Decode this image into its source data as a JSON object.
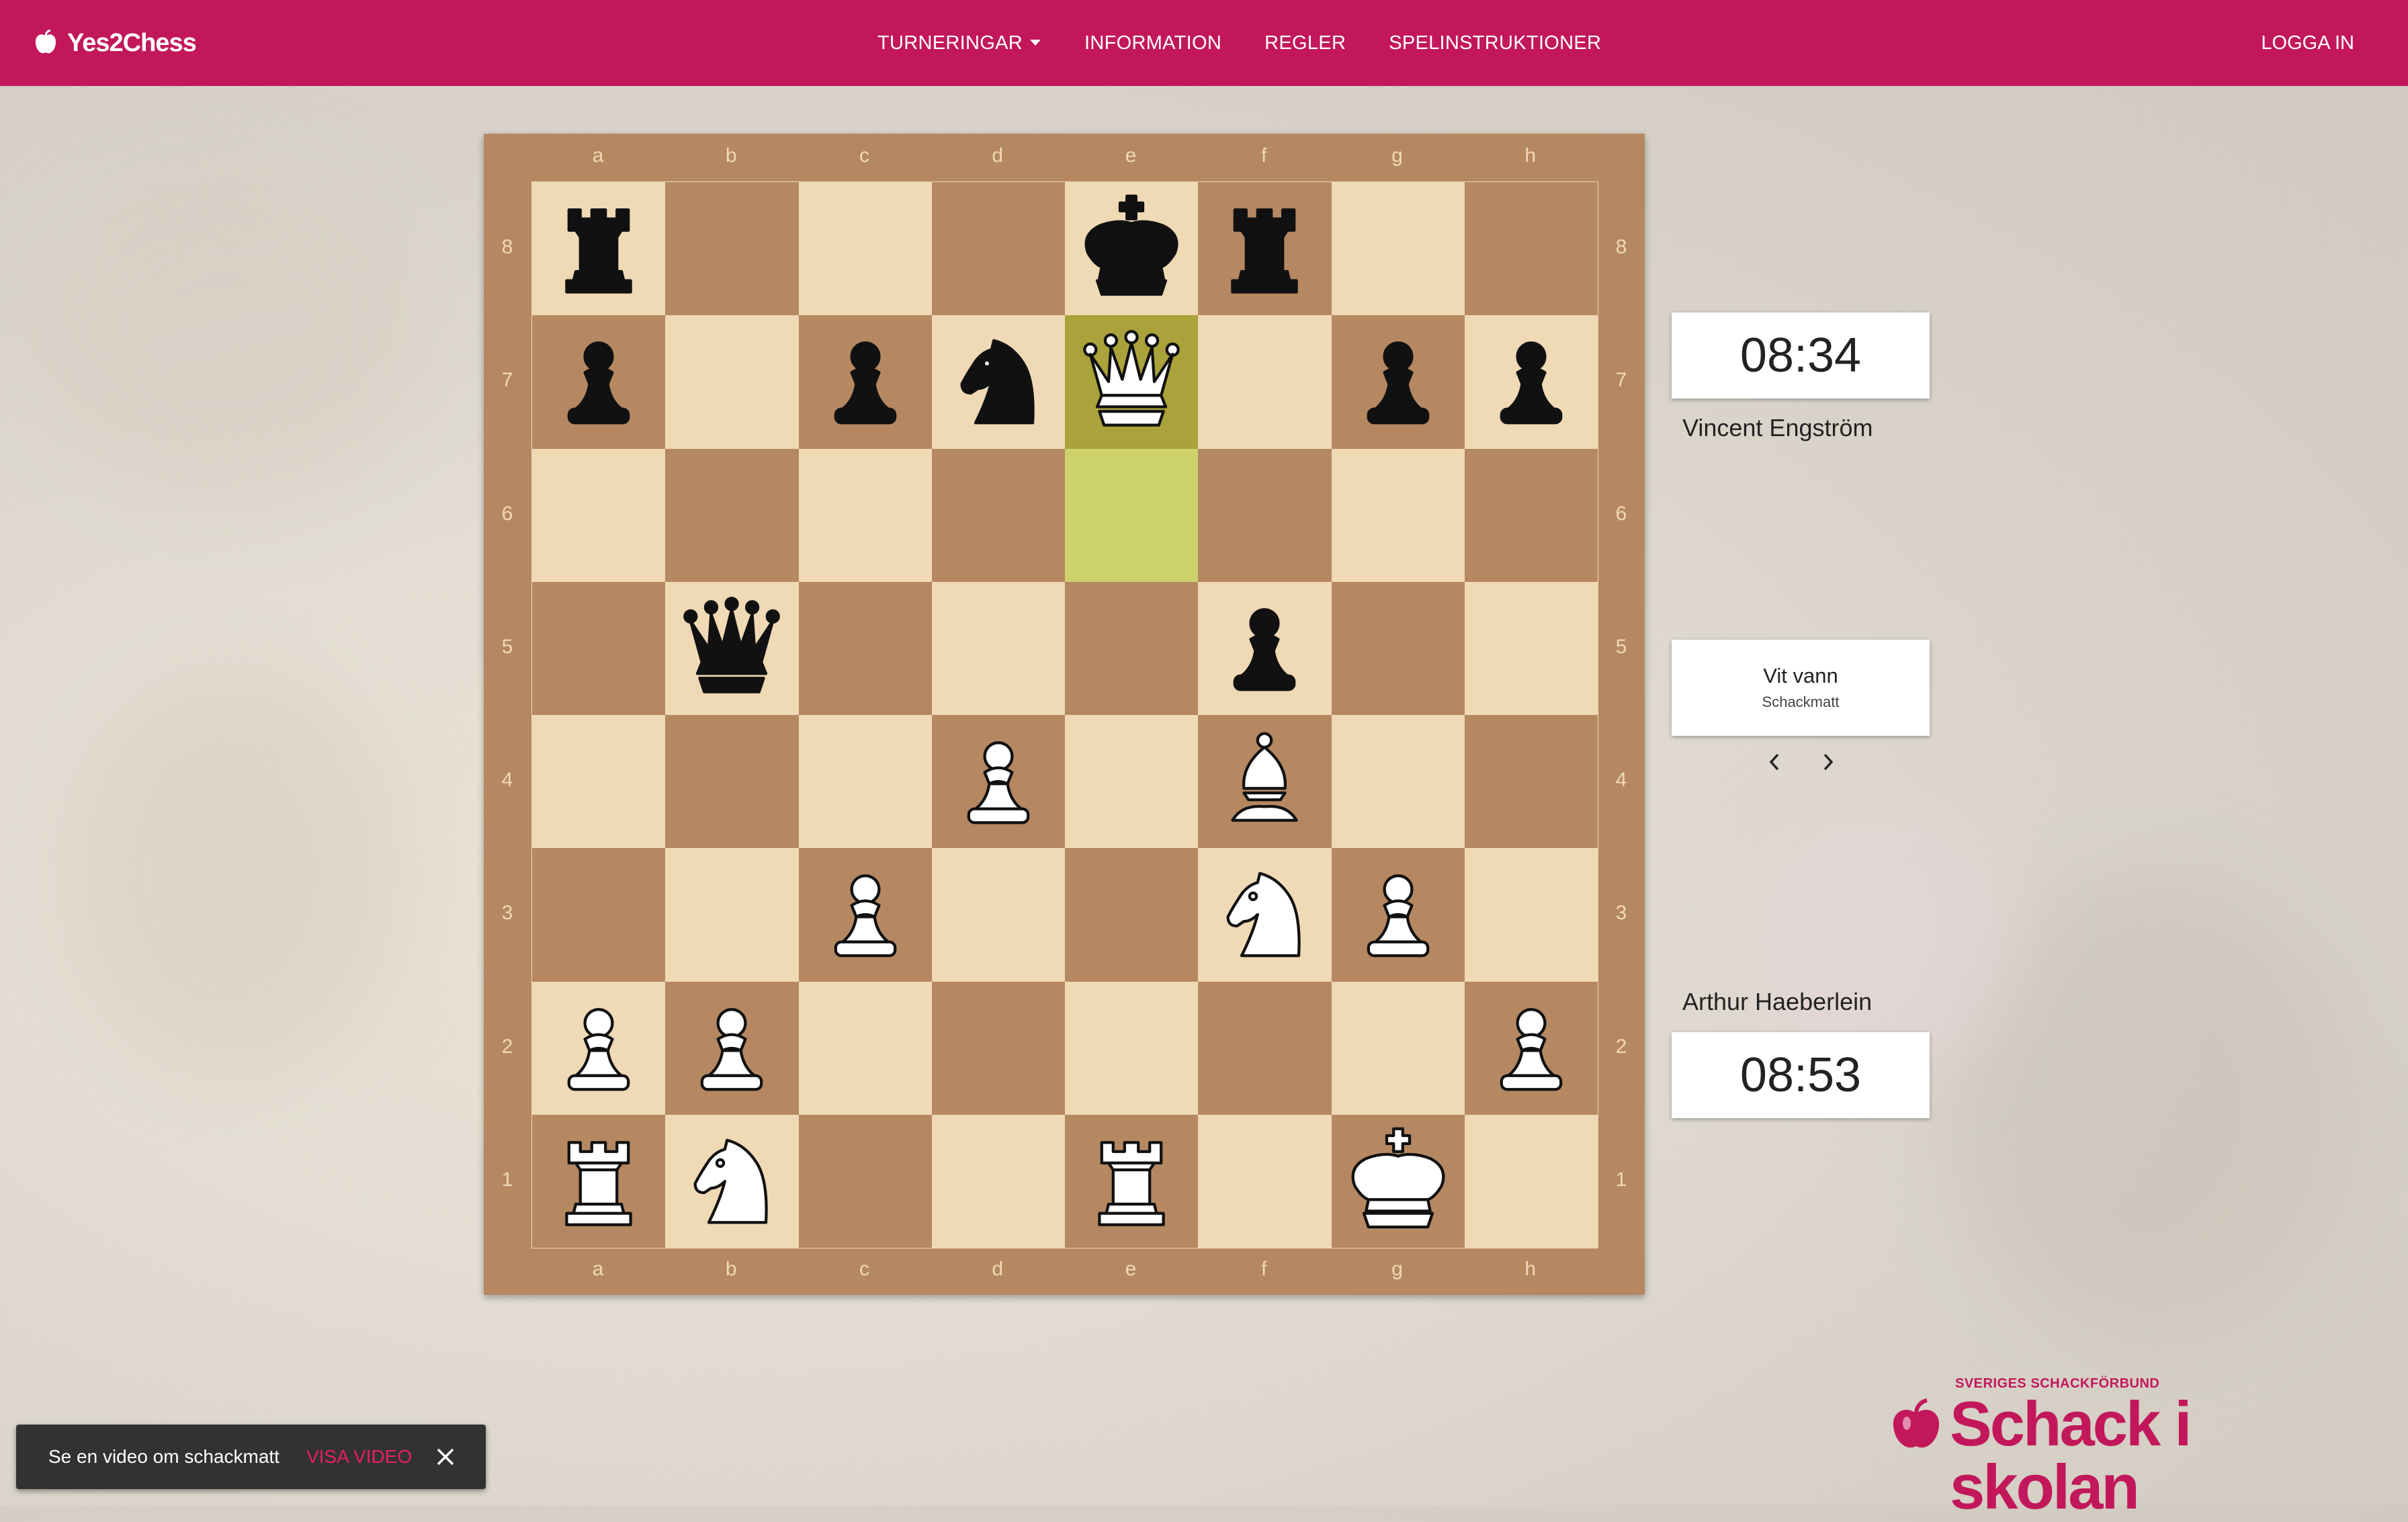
{
  "brand": {
    "name": "Yes2Chess"
  },
  "nav": {
    "items": [
      {
        "label": "TURNERINGAR",
        "dropdown": true
      },
      {
        "label": "INFORMATION"
      },
      {
        "label": "REGLER"
      },
      {
        "label": "SPELINSTRUKTIONER"
      }
    ],
    "login": "LOGGA IN"
  },
  "board": {
    "files": [
      "a",
      "b",
      "c",
      "d",
      "e",
      "f",
      "g",
      "h"
    ],
    "ranks": [
      "8",
      "7",
      "6",
      "5",
      "4",
      "3",
      "2",
      "1"
    ],
    "position": [
      [
        "br",
        "",
        "",
        "",
        "bk",
        "br",
        "",
        ""
      ],
      [
        "bp",
        "",
        "bp",
        "bn",
        "wq",
        "",
        "bp",
        "bp"
      ],
      [
        "",
        "",
        "",
        "",
        "",
        "",
        "",
        ""
      ],
      [
        "",
        "bq",
        "",
        "",
        "",
        "bp",
        "",
        ""
      ],
      [
        "",
        "",
        "",
        "wp",
        "",
        "wb",
        "",
        ""
      ],
      [
        "",
        "",
        "wp",
        "",
        "",
        "wn",
        "wp",
        ""
      ],
      [
        "wp",
        "wp",
        "",
        "",
        "",
        "",
        "",
        "wp"
      ],
      [
        "wr",
        "wn",
        "",
        "",
        "wr",
        "",
        "wk",
        ""
      ]
    ],
    "highlighted_squares": [
      "e7",
      "e6"
    ],
    "colors": {
      "light": "#f0d9b5",
      "dark": "#b58862",
      "highlight": "#cdd26a"
    }
  },
  "players": {
    "top": {
      "name": "Vincent Engström",
      "clock": "08:34"
    },
    "bottom": {
      "name": "Arthur Haeberlein",
      "clock": "08:53"
    }
  },
  "result": {
    "title": "Vit vann",
    "subtitle": "Schackmatt"
  },
  "snackbar": {
    "text": "Se en video om schackmatt",
    "action": "VISA VIDEO"
  },
  "footer_logo": {
    "top": "SVERIGES SCHACKFÖRBUND",
    "main": "Schack i skolan"
  },
  "theme": {
    "accent": "#c2185b"
  }
}
